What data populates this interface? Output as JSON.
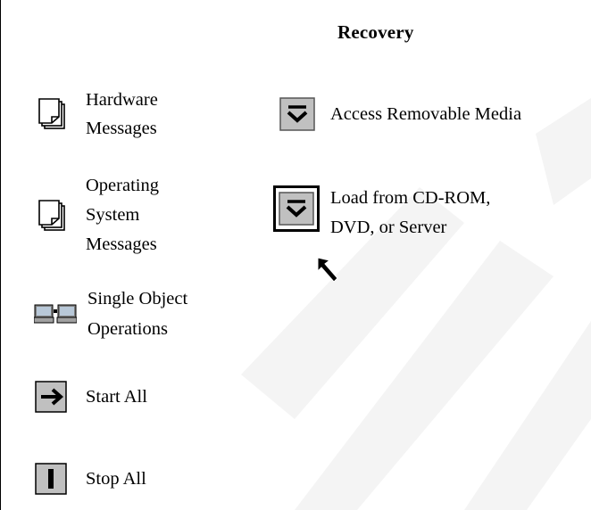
{
  "header": {
    "title": "Recovery"
  },
  "left_items": [
    {
      "icon": "document-stack-icon",
      "label": "Hardware\nMessages"
    },
    {
      "icon": "document-stack-icon",
      "label": "Operating\nSystem\nMessages"
    },
    {
      "icon": "terminals-icon",
      "label": "Single Object\nOperations"
    },
    {
      "icon": "arrow-right-icon",
      "label": "Start All"
    },
    {
      "icon": "stop-bar-icon",
      "label": "Stop All"
    }
  ],
  "right_items": [
    {
      "icon": "expand-down-icon",
      "label": "Access Removable Media"
    },
    {
      "icon": "expand-down-icon",
      "label": "Load from CD-ROM,\nDVD, or Server",
      "selected": true
    }
  ],
  "colors": {
    "icon_fill": "#c0c0c0",
    "selection_border": "#000000",
    "watermark": "#f3f3f3"
  }
}
